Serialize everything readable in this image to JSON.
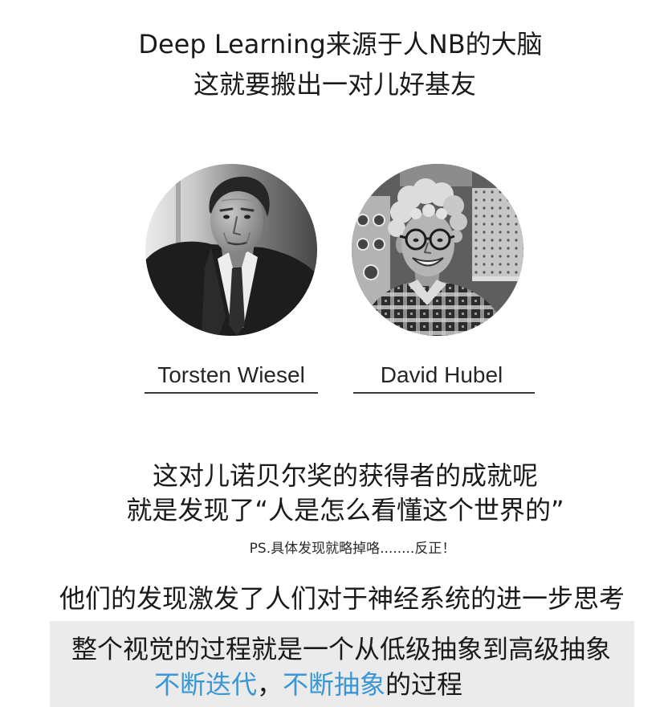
{
  "title": {
    "line1": "Deep Learning来源于人NB的大脑",
    "line2": "这就要搬出一对儿好基友"
  },
  "scientists": [
    {
      "name": "Torsten Wiesel"
    },
    {
      "name": "David Hubel"
    }
  ],
  "achievement": {
    "line1": "这对儿诺贝尔奖的获得者的成就呢",
    "line2": "就是发现了“人是怎么看懂这个世界的”"
  },
  "ps_note": "PS.具体发现就略掉咯........反正！",
  "inspiration": "他们的发现激发了人们对于神经系统的进一步思考",
  "summary": {
    "line1": "整个视觉的过程就是一个从低级抽象到高级抽象",
    "line2": {
      "highlight_1": "不断迭代",
      "separator": "，",
      "highlight_2": "不断抽象",
      "tail": "的过程"
    }
  },
  "colors": {
    "text": "#1a1a1a",
    "highlight": "#3a97d4",
    "summary_background": "#ebebeb",
    "underline": "#3a3a3a"
  }
}
